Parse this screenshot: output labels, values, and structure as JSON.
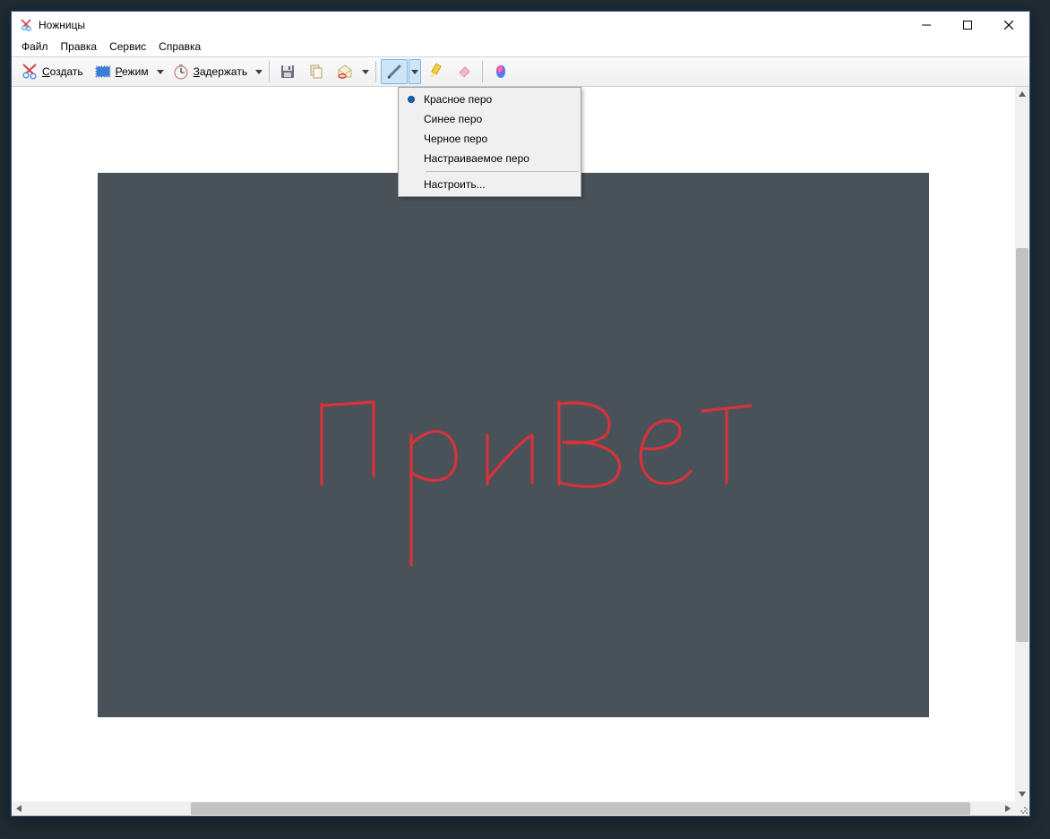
{
  "window": {
    "title": "Ножницы"
  },
  "menubar": {
    "file": "Файл",
    "edit": "Правка",
    "tools": "Сервис",
    "help": "Справка"
  },
  "toolbar": {
    "new_label": "Создать",
    "mode_label": "Режим",
    "delay_label": "Задержать"
  },
  "pen_menu": {
    "red": "Красное перо",
    "blue": "Синее перо",
    "black": "Черное перо",
    "custom": "Настраиваемое перо",
    "configure": "Настроить..."
  },
  "canvas": {
    "handwritten_text": "Привет"
  }
}
